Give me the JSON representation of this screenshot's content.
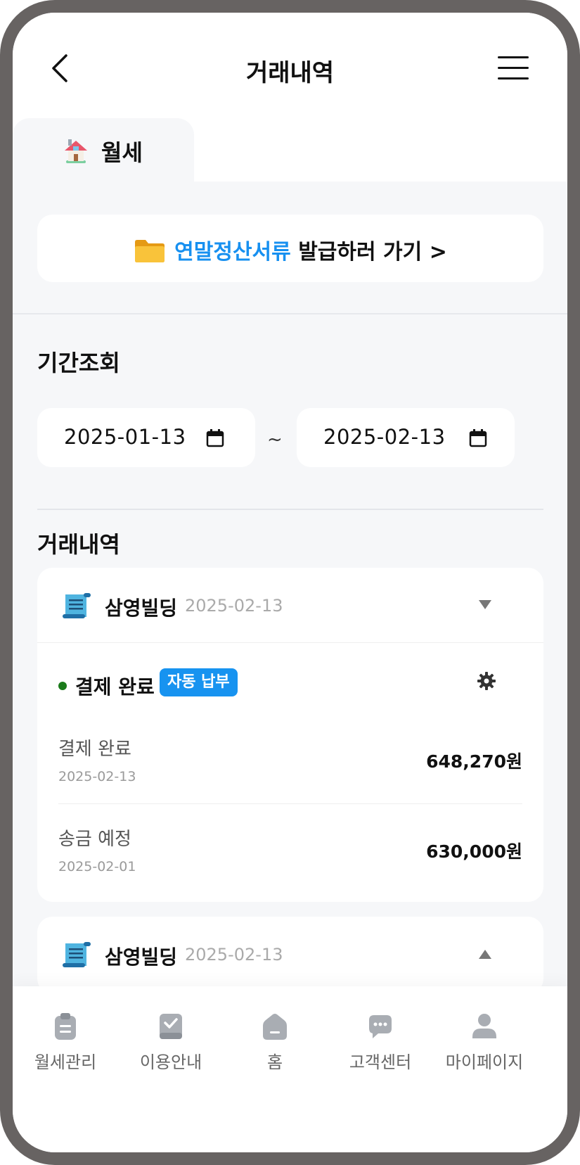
{
  "header": {
    "title": "거래내역"
  },
  "tabs": [
    {
      "label": "월세",
      "icon": "house-icon"
    }
  ],
  "banner": {
    "highlight": "연말정산서류",
    "rest": "발급하러 가기 >",
    "icon": "folder-icon",
    "highlight_color": "#1790f0"
  },
  "period": {
    "title": "기간조회",
    "start_date": "2025-01-13",
    "end_date": "2025-02-13",
    "separator": "~"
  },
  "history": {
    "title": "거래내역",
    "cards": [
      {
        "name": "삼영빌딩",
        "date": "2025-02-13",
        "expanded": true,
        "status": "결제 완료",
        "status_color": "#1a7a1a",
        "badge": "자동 납부",
        "badge_color": "#1793f0",
        "rows": [
          {
            "label": "결제 완료",
            "date": "2025-02-13",
            "amount": "648,270원"
          },
          {
            "label": "송금 예정",
            "date": "2025-02-01",
            "amount": "630,000원"
          }
        ]
      },
      {
        "name": "삼영빌딩",
        "date": "2025-02-13",
        "expanded": false
      }
    ]
  },
  "bottom_nav": [
    {
      "label": "월세관리",
      "icon": "clipboard-icon"
    },
    {
      "label": "이용안내",
      "icon": "book-check-icon"
    },
    {
      "label": "홈",
      "icon": "home-icon"
    },
    {
      "label": "고객센터",
      "icon": "chat-icon"
    },
    {
      "label": "마이페이지",
      "icon": "person-icon"
    }
  ]
}
